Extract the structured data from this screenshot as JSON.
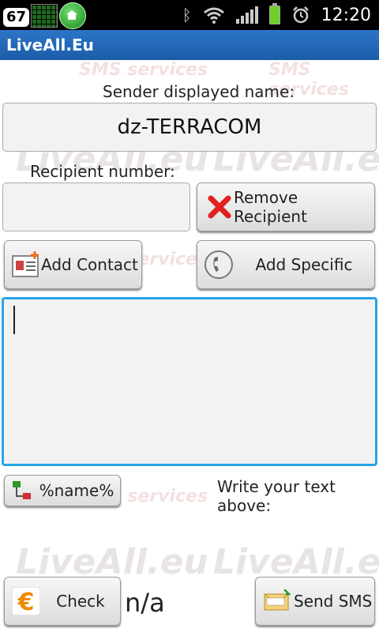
{
  "status_bar": {
    "notification_count": "67",
    "time": "12:20",
    "icons": [
      "grid-icon",
      "home-icon",
      "bluetooth-icon",
      "wifi-icon",
      "signal-icon",
      "battery-icon",
      "alarm-icon"
    ]
  },
  "app": {
    "title": "LiveAll.Eu"
  },
  "watermark": {
    "brand": "LiveAll.eu",
    "tagline": "SMS services"
  },
  "sender": {
    "label": "Sender displayed name:",
    "value": "dz-TERRACOM"
  },
  "recipient": {
    "label": "Recipient number:",
    "value": ""
  },
  "buttons": {
    "remove_recipient": "Remove Recipient",
    "add_contact": "Add Contact",
    "add_specific": "Add Specific",
    "name_placeholder": "%name%",
    "check": "Check",
    "send_sms": "Send SMS"
  },
  "message": {
    "value": "",
    "hint": "Write your text above:"
  },
  "credit": {
    "value": "n/a"
  },
  "colors": {
    "title_bar": "#1b5ca8",
    "focus_border": "#27a5e6",
    "remove_icon": "#e02020",
    "euro_icon": "#f08a00"
  }
}
